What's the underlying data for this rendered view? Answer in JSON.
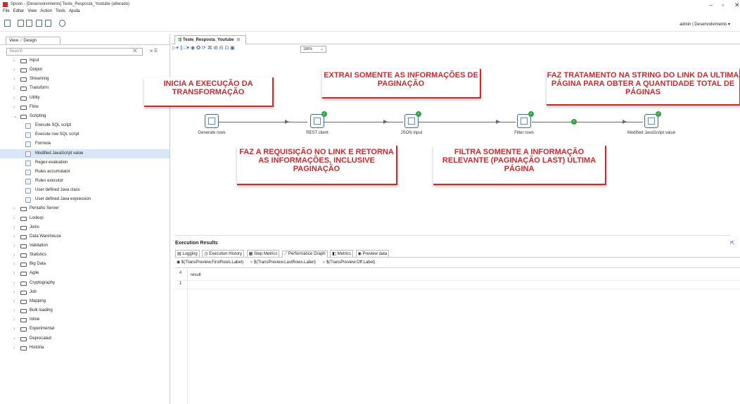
{
  "window": {
    "title": "Spoon - [Desenvolvimento] Teste_Resposta_Youtube (alterado)",
    "controls": [
      "–",
      "▫",
      "✕"
    ]
  },
  "menu": [
    "File",
    "Editar",
    "View",
    "Action",
    "Tools",
    "Ajuda"
  ],
  "toolbar": {
    "user_info": "admin | Desenvolvimento ▾"
  },
  "left_panel": {
    "tab_label": "View ⟋ Design",
    "search_placeholder": "Search",
    "tree": [
      {
        "label": "Input",
        "type": "cat"
      },
      {
        "label": "Output",
        "type": "cat"
      },
      {
        "label": "Streaming",
        "type": "cat"
      },
      {
        "label": "Transform",
        "type": "cat"
      },
      {
        "label": "Utility",
        "type": "cat"
      },
      {
        "label": "Flow",
        "type": "cat"
      },
      {
        "label": "Scripting",
        "type": "cat",
        "expanded": true
      },
      {
        "label": "Execute SQL script",
        "type": "sub"
      },
      {
        "label": "Execute row SQL script",
        "type": "sub"
      },
      {
        "label": "Formula",
        "type": "sub"
      },
      {
        "label": "Modified JavaScript value",
        "type": "sub",
        "selected": true
      },
      {
        "label": "Regex evaluation",
        "type": "sub"
      },
      {
        "label": "Rules accumulator",
        "type": "sub"
      },
      {
        "label": "Rules executor",
        "type": "sub"
      },
      {
        "label": "User defined Java class",
        "type": "sub"
      },
      {
        "label": "User defined Java expression",
        "type": "sub"
      },
      {
        "label": "Pentaho Server",
        "type": "cat"
      },
      {
        "label": "Lookup",
        "type": "cat"
      },
      {
        "label": "Joins",
        "type": "cat"
      },
      {
        "label": "Data Warehouse",
        "type": "cat"
      },
      {
        "label": "Validation",
        "type": "cat"
      },
      {
        "label": "Statistics",
        "type": "cat"
      },
      {
        "label": "Big Data",
        "type": "cat"
      },
      {
        "label": "Agile",
        "type": "cat"
      },
      {
        "label": "Cryptography",
        "type": "cat"
      },
      {
        "label": "Job",
        "type": "cat"
      },
      {
        "label": "Mapping",
        "type": "cat"
      },
      {
        "label": "Bulk loading",
        "type": "cat"
      },
      {
        "label": "Inline",
        "type": "cat"
      },
      {
        "label": "Experimental",
        "type": "cat"
      },
      {
        "label": "Deprecated",
        "type": "cat"
      },
      {
        "label": "História",
        "type": "cat"
      }
    ]
  },
  "editor": {
    "tab_label": "Teste_Resposta_Youtube",
    "zoom": "100%"
  },
  "steps": [
    {
      "label": "Generate rows"
    },
    {
      "label": "REST client"
    },
    {
      "label": "JSON input"
    },
    {
      "label": "Filter rows"
    },
    {
      "label": "Modified JavaScript value"
    }
  ],
  "notes": [
    {
      "text": "INICIA A EXECUÇÃO DA TRANSFORMAÇÃO"
    },
    {
      "text": "EXTRAI SOMENTE AS INFORMAÇÕES DE PAGINAÇÃO"
    },
    {
      "text": "FAZ TRATAMENTO NA STRING DO LINK DA ULTIMA PÁGINA PARA OBTER A QUANTIDADE TOTAL DE PÁGINAS"
    },
    {
      "text": "FAZ A REQUISIÇÃO NO LINK E RETORNA AS INFORMAÇÕES, INCLUSIVE PAGINAÇÃO"
    },
    {
      "text": "FILTRA SOMENTE A INFORMAÇÃO RELEVANTE (PAGINAÇÃO LAST) ÚLTIMA PÁGINA"
    }
  ],
  "results": {
    "title": "Execution Results",
    "tabs": [
      "Logging",
      "Execution History",
      "Step Metrics",
      "Performance Graph",
      "Metrics",
      "Preview data"
    ],
    "radios": [
      "$(TransPreview.FirstRows.Label)",
      "$(TransPreview.LastRows.Label)",
      "$(TransPreview.Off.Label)"
    ],
    "columns": [
      "#",
      "result"
    ],
    "rows": [
      "1"
    ]
  },
  "colors": {
    "note_red": "#d5272b",
    "hop_blue": "#4e6ea6",
    "ok_green": "#2fa843"
  }
}
